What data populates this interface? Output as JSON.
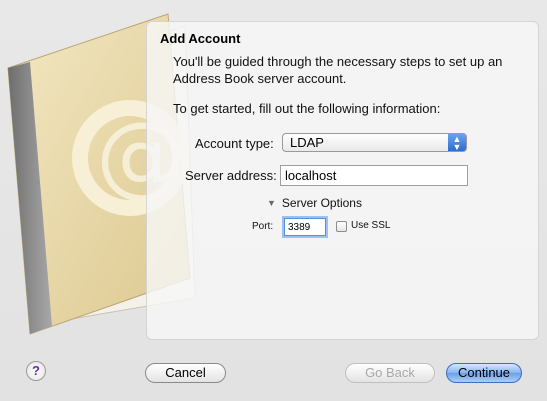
{
  "dialog": {
    "title": "Add Account",
    "intro": "You'll be guided through the necessary steps to set up an Address Book server account.",
    "instruction": "To get started, fill out the following information:"
  },
  "form": {
    "account_type_label": "Account type:",
    "account_type_value": "LDAP",
    "server_address_label": "Server address:",
    "server_address_value": "localhost",
    "server_options_label": "Server Options",
    "port_label": "Port:",
    "port_value": "3389",
    "use_ssl_label": "Use SSL",
    "use_ssl_checked": false
  },
  "buttons": {
    "help": "?",
    "cancel": "Cancel",
    "go_back": "Go Back",
    "continue": "Continue"
  },
  "icons": {
    "help": "help-icon",
    "book": "address-book-icon",
    "popup_arrows": "chevron-up-down-icon",
    "disclosure": "disclosure-triangle-icon"
  },
  "colors": {
    "accent": "#3d6ec2",
    "help_mark": "#6a2aa8",
    "book_cover": "#e9d9a8",
    "book_spine": "#8c8c8c"
  }
}
